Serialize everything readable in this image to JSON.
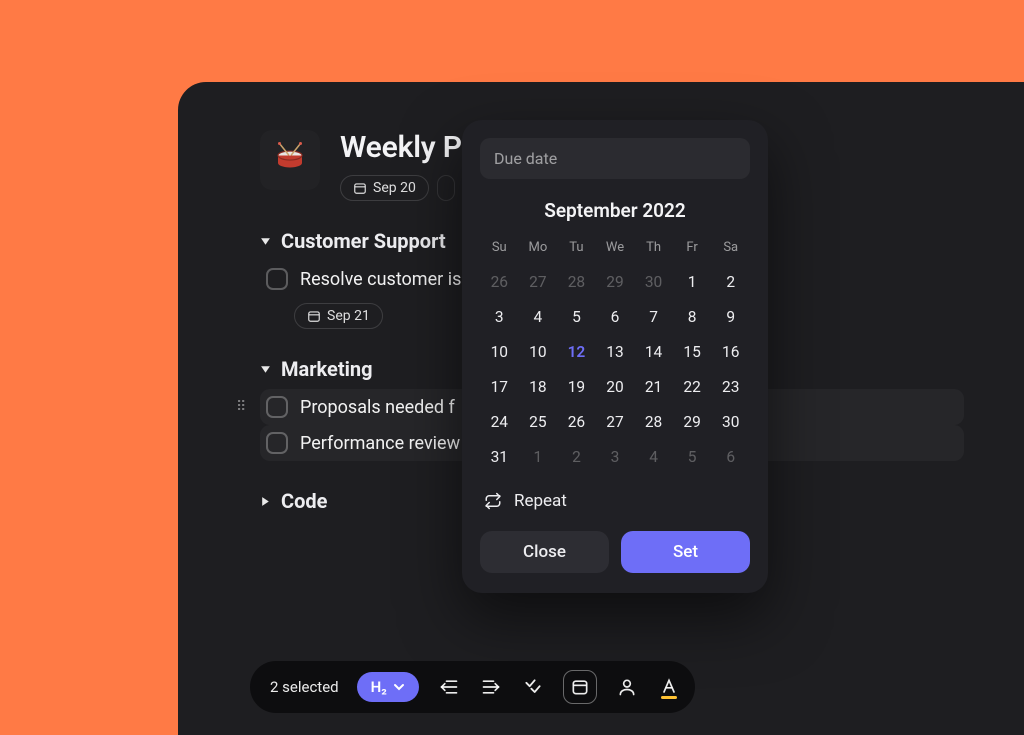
{
  "header": {
    "title": "Weekly P",
    "date_chip": "Sep 20"
  },
  "sections": {
    "cs": {
      "title": "Customer Support"
    },
    "mk": {
      "title": "Marketing"
    },
    "cd": {
      "title": "Code"
    }
  },
  "tasks": {
    "cs0": {
      "label": "Resolve customer is",
      "date": "Sep 21"
    },
    "mk0": {
      "label": "Proposals needed f"
    },
    "mk1": {
      "label": "Performance review"
    }
  },
  "popover": {
    "placeholder": "Due date",
    "month": "September 2022",
    "dow": [
      "Su",
      "Mo",
      "Tu",
      "We",
      "Th",
      "Fr",
      "Sa"
    ],
    "days": [
      "26",
      "27",
      "28",
      "29",
      "30",
      "1",
      "2",
      "3",
      "4",
      "5",
      "6",
      "7",
      "8",
      "9",
      "10",
      "10",
      "12",
      "13",
      "14",
      "15",
      "16",
      "17",
      "18",
      "19",
      "20",
      "21",
      "22",
      "23",
      "24",
      "25",
      "26",
      "27",
      "28",
      "29",
      "30",
      "31",
      "1",
      "2",
      "3",
      "4",
      "5",
      "6"
    ],
    "repeat": "Repeat",
    "close": "Close",
    "set": "Set"
  },
  "toolbar": {
    "count": "2 selected",
    "heading": "H₂"
  }
}
